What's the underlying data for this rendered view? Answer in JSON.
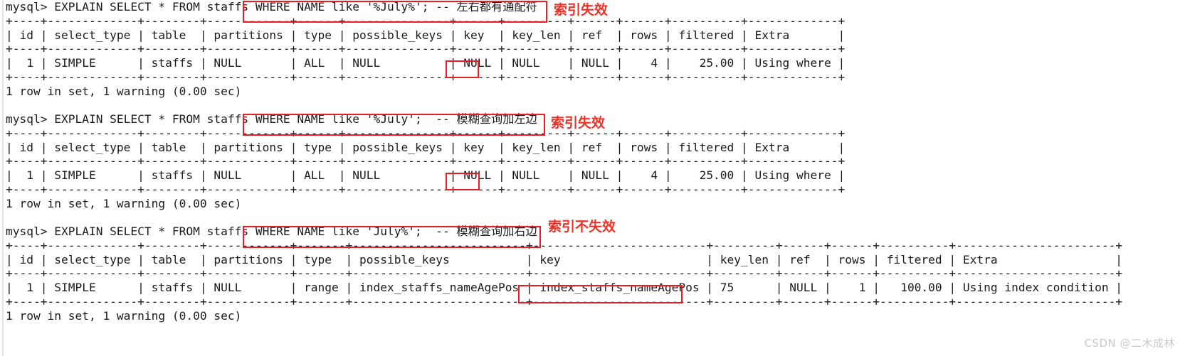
{
  "terminal": {
    "prompt": "mysql>",
    "blocks": [
      {
        "id": "block-1",
        "command_line": "mysql> EXPLAIN SELECT * FROM staffs WHERE NAME like '%July%'; -- 左右都有通配符",
        "sql_fragment": "WHERE NAME like '%July%'; -- 左右都有通配符",
        "annotation": "索引失效",
        "separator": "+----+-------------+--------+------------+------+---------------+------+---------+------+------+----------+-------------+",
        "header_row": "| id | select_type | table  | partitions | type | possible_keys | key  | key_len | ref  | rows | filtered | Extra       |",
        "data_row": "|  1 | SIMPLE      | staffs | NULL       | ALL  | NULL          | NULL | NULL    | NULL |    4 |    25.00 | Using where |",
        "status": "1 row in set, 1 warning (0.00 sec)",
        "columns": [
          "id",
          "select_type",
          "table",
          "partitions",
          "type",
          "possible_keys",
          "key",
          "key_len",
          "ref",
          "rows",
          "filtered",
          "Extra"
        ],
        "values": [
          "1",
          "SIMPLE",
          "staffs",
          "NULL",
          "ALL",
          "NULL",
          "NULL",
          "NULL",
          "NULL",
          "4",
          "25.00",
          "Using where"
        ],
        "highlighted_cell": "NULL"
      },
      {
        "id": "block-2",
        "command_line": "mysql> EXPLAIN SELECT * FROM staffs WHERE NAME like '%July';  -- 模糊查询加左边",
        "sql_fragment": "WHERE NAME like '%July';  -- 模糊查询加左边",
        "annotation": "索引失效",
        "separator": "+----+-------------+--------+------------+------+---------------+------+---------+------+------+----------+-------------+",
        "header_row": "| id | select_type | table  | partitions | type | possible_keys | key  | key_len | ref  | rows | filtered | Extra       |",
        "data_row": "|  1 | SIMPLE      | staffs | NULL       | ALL  | NULL          | NULL | NULL    | NULL |    4 |    25.00 | Using where |",
        "status": "1 row in set, 1 warning (0.00 sec)",
        "columns": [
          "id",
          "select_type",
          "table",
          "partitions",
          "type",
          "possible_keys",
          "key",
          "key_len",
          "ref",
          "rows",
          "filtered",
          "Extra"
        ],
        "values": [
          "1",
          "SIMPLE",
          "staffs",
          "NULL",
          "ALL",
          "NULL",
          "NULL",
          "NULL",
          "NULL",
          "4",
          "25.00",
          "Using where"
        ],
        "highlighted_cell": "NULL"
      },
      {
        "id": "block-3",
        "command_line": "mysql> EXPLAIN SELECT * FROM staffs WHERE NAME like 'July%';  -- 模糊查询加右边",
        "sql_fragment": "WHERE NAME like 'July%';  -- 模糊查询加右边",
        "annotation": "索引不失效",
        "separator": "+----+-------------+--------+------------+-------+-----------------------+-----------------------+---------+------+------+----------+-----------------------+",
        "header_row": "| id | select_type | table  | partitions | type  | possible_keys         | key                   | key_len | ref  | rows | filtered | Extra                 |",
        "data_row": "|  1 | SIMPLE      | staffs | NULL       | range | index_staffs_nameAgePos | index_staffs_nameAgePos | 75      | NULL |    1 |   100.00 | Using index condition |",
        "status": "1 row in set, 1 warning (0.00 sec)",
        "columns": [
          "id",
          "select_type",
          "table",
          "partitions",
          "type",
          "possible_keys",
          "key",
          "key_len",
          "ref",
          "rows",
          "filtered",
          "Extra"
        ],
        "values": [
          "1",
          "SIMPLE",
          "staffs",
          "NULL",
          "range",
          "index_staffs_nameAgePos",
          "index_staffs_nameAgePos",
          "75",
          "NULL",
          "1",
          "100.00",
          "Using index condition"
        ],
        "highlighted_cell": "index_staffs_nameAgePos"
      }
    ],
    "full_text": "mysql> EXPLAIN SELECT * FROM staffs WHERE NAME like '%July%'; -- 左右都有通配符\n+----+-------------+--------+------------+------+---------------+------+---------+------+------+----------+-------------+\n| id | select_type | table  | partitions | type | possible_keys | key  | key_len | ref  | rows | filtered | Extra       |\n+----+-------------+--------+------------+------+---------------+------+---------+------+------+----------+-------------+\n|  1 | SIMPLE      | staffs | NULL       | ALL  | NULL          | NULL | NULL    | NULL |    4 |    25.00 | Using where |\n+----+-------------+--------+------------+------+---------------+------+---------+------+------+----------+-------------+\n1 row in set, 1 warning (0.00 sec)\n\nmysql> EXPLAIN SELECT * FROM staffs WHERE NAME like '%July';  -- 模糊查询加左边\n+----+-------------+--------+------------+------+---------------+------+---------+------+------+----------+-------------+\n| id | select_type | table  | partitions | type | possible_keys | key  | key_len | ref  | rows | filtered | Extra       |\n+----+-------------+--------+------------+------+---------------+------+---------+------+------+----------+-------------+\n|  1 | SIMPLE      | staffs | NULL       | ALL  | NULL          | NULL | NULL    | NULL |    4 |    25.00 | Using where |\n+----+-------------+--------+------------+------+---------------+------+---------+------+------+----------+-------------+\n1 row in set, 1 warning (0.00 sec)\n\nmysql> EXPLAIN SELECT * FROM staffs WHERE NAME like 'July%';  -- 模糊查询加右边\n+----+-------------+--------+------------+-------+-------------------------+-------------------------+---------+------+------+----------+-----------------------+\n| id | select_type | table  | partitions | type  | possible_keys           | key                     | key_len | ref  | rows | filtered | Extra                 |\n+----+-------------+--------+------------+-------+-------------------------+-------------------------+---------+------+------+----------+-----------------------+\n|  1 | SIMPLE      | staffs | NULL       | range | index_staffs_nameAgePos | index_staffs_nameAgePos | 75      | NULL |    1 |   100.00 | Using index condition |\n+----+-------------+--------+------------+-------+-------------------------+-------------------------+---------+------+------+----------+-----------------------+\n1 row in set, 1 warning (0.00 sec)"
  },
  "annotations": {
    "note1": "索引失效",
    "note2": "索引失效",
    "note3": "索引不失效",
    "accent_color": "#ee3124"
  },
  "watermark": {
    "text": "CSDN @二木成林"
  }
}
